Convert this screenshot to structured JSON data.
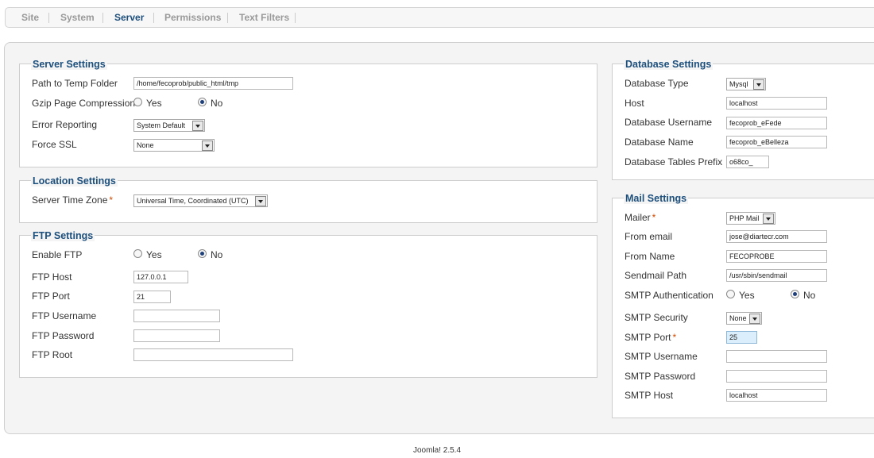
{
  "tabs": [
    "Site",
    "System",
    "Server",
    "Permissions",
    "Text Filters"
  ],
  "server_settings": {
    "legend": "Server Settings",
    "temp_folder_label": "Path to Temp Folder",
    "temp_folder_value": "/home/fecoprob/public_html/tmp",
    "gzip_label": "Gzip Page Compression",
    "yes": "Yes",
    "no": "No",
    "gzip_selected": "No",
    "error_reporting_label": "Error Reporting",
    "error_reporting_value": "System Default",
    "force_ssl_label": "Force SSL",
    "force_ssl_value": "None"
  },
  "location_settings": {
    "legend": "Location Settings",
    "timezone_label": "Server Time Zone",
    "required_mark": "*",
    "timezone_value": "Universal Time, Coordinated (UTC)"
  },
  "ftp_settings": {
    "legend": "FTP Settings",
    "enable_label": "Enable FTP",
    "yes": "Yes",
    "no": "No",
    "enable_selected": "No",
    "host_label": "FTP Host",
    "host_value": "127.0.0.1",
    "port_label": "FTP Port",
    "port_value": "21",
    "username_label": "FTP Username",
    "username_value": "",
    "password_label": "FTP Password",
    "password_value": "",
    "root_label": "FTP Root",
    "root_value": ""
  },
  "database_settings": {
    "legend": "Database Settings",
    "type_label": "Database Type",
    "type_value": "Mysql",
    "host_label": "Host",
    "host_value": "localhost",
    "username_label": "Database Username",
    "username_value": "fecoprob_eFede",
    "name_label": "Database Name",
    "name_value": "fecoprob_eBelleza",
    "prefix_label": "Database Tables Prefix",
    "prefix_value": "o68co_"
  },
  "mail_settings": {
    "legend": "Mail Settings",
    "mailer_label": "Mailer",
    "required_mark": "*",
    "mailer_value": "PHP Mail",
    "from_email_label": "From email",
    "from_email_value": "jose@diartecr.com",
    "from_name_label": "From Name",
    "from_name_value": "FECOPROBE",
    "sendmail_label": "Sendmail Path",
    "sendmail_value": "/usr/sbin/sendmail",
    "smtp_auth_label": "SMTP Authentication",
    "yes": "Yes",
    "no": "No",
    "smtp_auth_selected": "No",
    "smtp_security_label": "SMTP Security",
    "smtp_security_value": "None",
    "smtp_port_label": "SMTP Port",
    "smtp_port_value": "25",
    "smtp_username_label": "SMTP Username",
    "smtp_username_value": "",
    "smtp_password_label": "SMTP Password",
    "smtp_password_value": "",
    "smtp_host_label": "SMTP Host",
    "smtp_host_value": "localhost"
  },
  "footer": {
    "version": "Joomla! 2.5.4"
  },
  "colors": {
    "legend": "#1d4f7c",
    "required": "#d04a02",
    "active_tab": "#1d4f7c"
  }
}
